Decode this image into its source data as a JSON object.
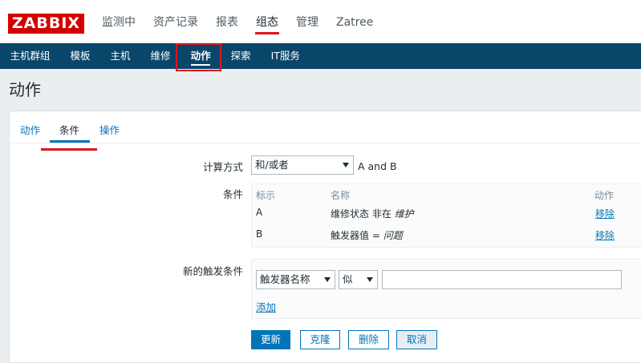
{
  "app": {
    "logo_text": "ZABBIX"
  },
  "top_nav": [
    "监测中",
    "资产记录",
    "报表",
    "组态",
    "管理",
    "Zatree"
  ],
  "sub_nav": [
    "主机群组",
    "模板",
    "主机",
    "维修",
    "动作",
    "探索",
    "IT服务"
  ],
  "page_title": "动作",
  "tabs": [
    "动作",
    "条件",
    "操作"
  ],
  "form": {
    "calc_label": "计算方式",
    "calc_select": "和/或者",
    "calc_expression": "A and B",
    "conditions_label": "条件",
    "conditions": {
      "headers": {
        "label": "标示",
        "name": "名称",
        "action": "动作"
      },
      "rows": [
        {
          "label": "A",
          "name_prefix": "维修状态 非在 ",
          "name_value": "维护",
          "action": "移除"
        },
        {
          "label": "B",
          "name_prefix": "触发器值 = ",
          "name_value": "问题",
          "action": "移除"
        }
      ]
    },
    "new_condition_label": "新的触发条件",
    "new_condition": {
      "type_select": "触发器名称",
      "operator_select": "似",
      "value": "",
      "add_link": "添加"
    }
  },
  "buttons": {
    "update": "更新",
    "clone": "克隆",
    "delete": "删除",
    "cancel": "取消"
  },
  "colors": {
    "brand_red": "#d40000",
    "nav_blue": "#0a466a",
    "link_blue": "#0275b8",
    "highlight_red": "#e0141e"
  }
}
